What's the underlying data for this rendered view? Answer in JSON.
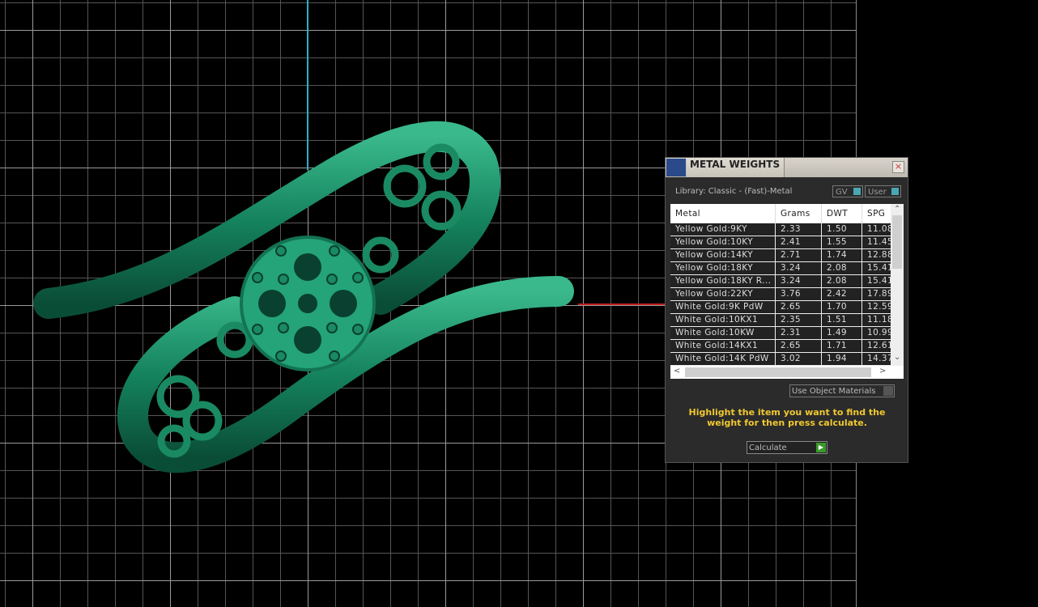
{
  "dialog": {
    "title": "METAL WEIGHTS",
    "close_label": "×",
    "library": "Library: Classic - (Fast)-Metal",
    "toggle_gv": "GV",
    "toggle_user": "User",
    "columns": [
      "Metal",
      "Grams",
      "DWT",
      "SPG"
    ],
    "rows": [
      [
        "Yellow Gold:9KY",
        "2.33",
        "1.50",
        "11.08"
      ],
      [
        "Yellow Gold:10KY",
        "2.41",
        "1.55",
        "11.45"
      ],
      [
        "Yellow Gold:14KY",
        "2.71",
        "1.74",
        "12.88"
      ],
      [
        "Yellow Gold:18KY",
        "3.24",
        "2.08",
        "15.41"
      ],
      [
        "Yellow Gold:18KY R...",
        "3.24",
        "2.08",
        "15.41"
      ],
      [
        "Yellow Gold:22KY",
        "3.76",
        "2.42",
        "17.89"
      ],
      [
        "White Gold:9K PdW",
        "2.65",
        "1.70",
        "12.59"
      ],
      [
        "White Gold:10KX1",
        "2.35",
        "1.51",
        "11.18"
      ],
      [
        "White Gold:10KW",
        "2.31",
        "1.49",
        "10.99"
      ],
      [
        "White Gold:14KX1",
        "2.65",
        "1.71",
        "12.61"
      ],
      [
        "White Gold:14K PdW",
        "3.02",
        "1.94",
        "14.37"
      ]
    ],
    "use_object_materials": "Use Object Materials",
    "hint": "Highlight the item you want to find the weight for then press calculate.",
    "calculate": "Calculate"
  },
  "colors": {
    "ring": "#1f8a66",
    "accent_hint": "#f0c830",
    "axis_y": "#2ab0c0",
    "axis_x": "#c02020"
  }
}
